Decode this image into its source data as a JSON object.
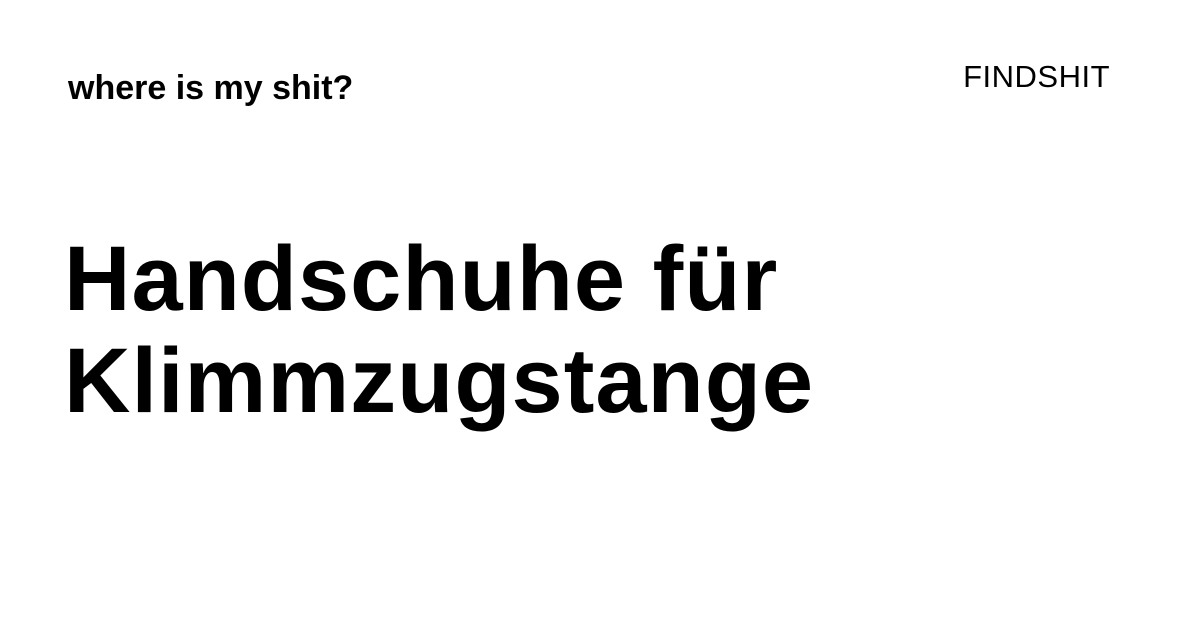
{
  "header": {
    "tagline": "where is my shit?",
    "brand": "FINDSHIT"
  },
  "main": {
    "title_lines": [
      "Handschuhe für",
      "Klimmzugstange"
    ]
  },
  "colors": {
    "background": "#ffffff",
    "text": "#000000"
  }
}
